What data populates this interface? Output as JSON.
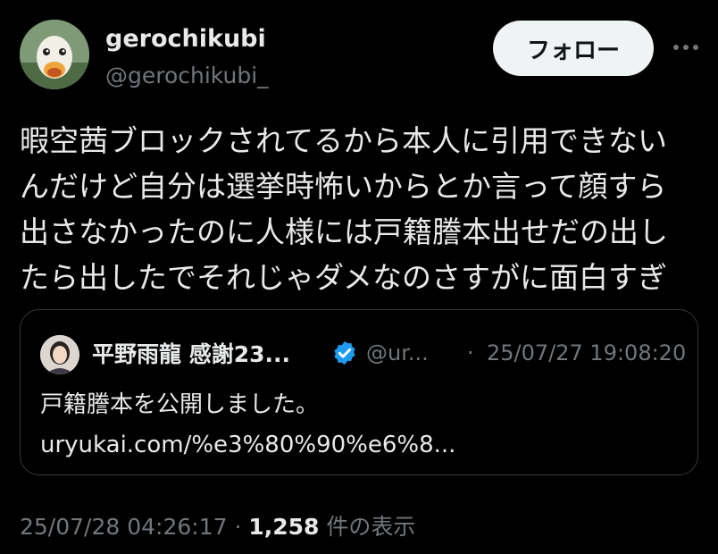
{
  "author": {
    "display_name": "gerochikubi",
    "handle": "@gerochikubi_",
    "avatar_icon": "duck-avatar"
  },
  "follow_label": "フォロー",
  "more_icon": "more-dots-icon",
  "tweet": {
    "lines": [
      "暇空茜ブロックされてるから本人に引用できない",
      "んだけど自分は選挙時怖いからとか言って顔すら",
      "出さなかったのに人様には戸籍謄本出せだの出し",
      "たら出したでそれじゃダメなのさすがに面白すぎ"
    ]
  },
  "quote": {
    "display_name": "平野雨龍 感謝23...",
    "handle": "@ur...",
    "separator": "·",
    "timestamp": "25/07/27 19:08:20",
    "text_line1": "戸籍謄本を公開しました。",
    "text_line2": "uryukai.com/%e3%80%90%e6%8...",
    "verified_icon": "verified-badge-icon",
    "verified_color": "#1d9bf0"
  },
  "meta": {
    "timestamp": "25/07/28 04:26:17",
    "separator": "·",
    "views_count": "1,258",
    "views_label": "件の表示"
  },
  "colors": {
    "background": "#000000",
    "text_primary": "#e7e9ea",
    "text_secondary": "#71767b",
    "border": "#333639",
    "follow_bg": "#eff3f4"
  }
}
